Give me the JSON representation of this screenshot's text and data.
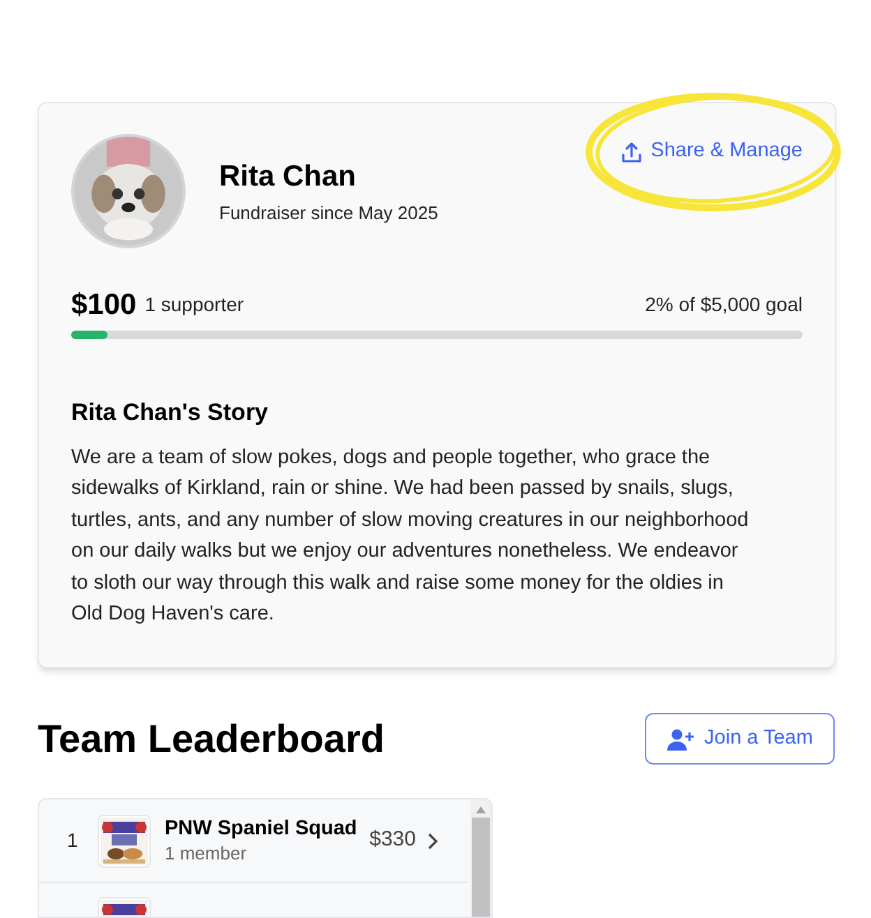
{
  "profile": {
    "name": "Rita Chan",
    "subtitle": "Fundraiser since May 2025",
    "share_link": "Share & Manage"
  },
  "progress": {
    "amount": "$100",
    "supporters": "1 supporter",
    "goal": "2% of $5,000 goal",
    "level": 0.05
  },
  "story": {
    "title": "Rita Chan's Story",
    "text": "We are a team of slow pokes, dogs and people together, who grace the sidewalks of Kirkland, rain or shine. We had been passed by snails, slugs, turtles, ants, and any number of slow moving creatures in our neighborhood on our daily walks but we enjoy our adventures nonetheless. We endeavor to sloth our way through this walk and raise some money for the oldies in Old Dog Haven's care."
  },
  "leaderboard": {
    "title": "Team Leaderboard",
    "join_button": "Join a Team",
    "rows": [
      {
        "kind": "full",
        "rank": "1",
        "name": "PNW Spaniel Squad",
        "members": "1 member",
        "amount": "$330"
      },
      {
        "kind": "clipped"
      }
    ]
  }
}
